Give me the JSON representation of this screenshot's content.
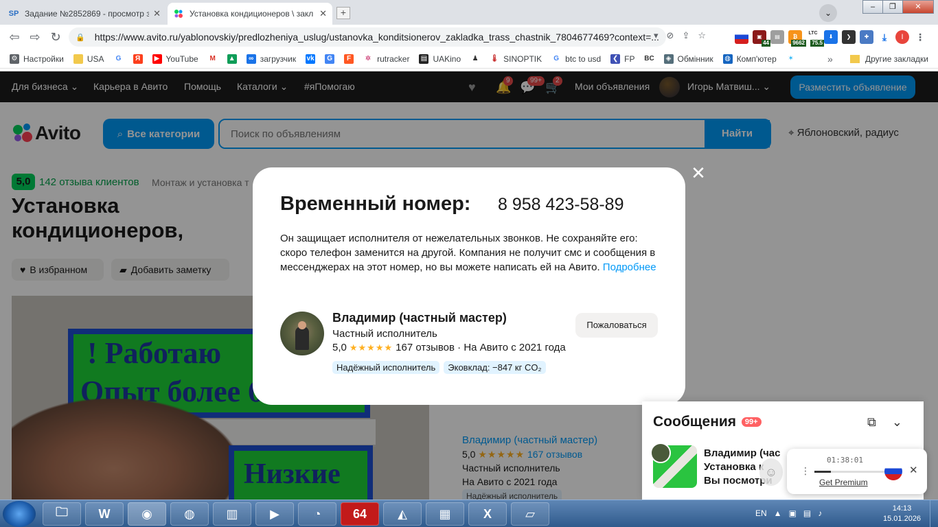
{
  "browser": {
    "tabs": [
      {
        "favicon": "SP",
        "title": "Задание №2852869 - просмотр за",
        "active": false
      },
      {
        "favicon": "avito-dots",
        "title": "Установка кондиционеров \\ закл",
        "active": true
      }
    ],
    "url": "https://www.avito.ru/yablonovskiy/predlozheniya_uslug/ustanovka_konditsionerov_zakladka_trass_chastnik_7804677469?context=...",
    "extensions": {
      "badge_44": "44",
      "badge_9662": "9662",
      "ltc_label": "LTC",
      "ltc_value": "75.5",
      "profile_letter": "I"
    },
    "bookmarks": [
      {
        "icon": "gear-icon",
        "label": "Настройки"
      },
      {
        "icon": "folder-icon",
        "label": "USA"
      },
      {
        "icon": "google-icon",
        "label": ""
      },
      {
        "icon": "yandex-icon",
        "label": ""
      },
      {
        "icon": "youtube-icon",
        "label": "YouTube"
      },
      {
        "icon": "gmail-icon",
        "label": ""
      },
      {
        "icon": "drive-icon",
        "label": ""
      },
      {
        "icon": "infinity-icon",
        "label": "загрузчик"
      },
      {
        "icon": "vk-icon",
        "label": ""
      },
      {
        "icon": "translate-icon",
        "label": ""
      },
      {
        "icon": "f-icon",
        "label": ""
      },
      {
        "icon": "rutracker-icon",
        "label": "rutracker"
      },
      {
        "icon": "uakino-icon",
        "label": "UAKino"
      },
      {
        "icon": "pawn-icon",
        "label": ""
      },
      {
        "icon": "thermometer-icon",
        "label": "SINOPTIK"
      },
      {
        "icon": "google-icon",
        "label": "btc to usd"
      },
      {
        "icon": "fp-icon",
        "label": "FP"
      },
      {
        "icon": "bc-icon",
        "label": ""
      },
      {
        "icon": "exchange-icon",
        "label": "Обмінник"
      },
      {
        "icon": "globe-icon",
        "label": "Комп'ютер"
      },
      {
        "icon": "star-icon",
        "label": ""
      }
    ],
    "bookmarks_more": "»",
    "other_bookmarks": "Другие закладки"
  },
  "avito": {
    "topnav": {
      "business": "Для бизнеса",
      "career": "Карьера в Авито",
      "help": "Помощь",
      "catalogs": "Каталоги",
      "helping": "#яПомогаю",
      "notif_count": "9",
      "messages_count": "99+",
      "cart_count": "2",
      "my_ads": "Мои объявления",
      "user_name": "Игорь Матвиш...",
      "place_ad": "Разместить объявление"
    },
    "logo_text": "Avito",
    "all_categories": "Все категории",
    "search_placeholder": "Поиск по объявлениям",
    "search_button": "Найти",
    "location": "Яблоновский, радиус",
    "rating": "5,0",
    "reviews_count": "142 отзыва клиентов",
    "breadcrumb": "Монтаж и установка т",
    "title": "Установка кондиционеров, закладка трасс (частник)",
    "favorite_button": "В избранном",
    "note_button": "Добавить заметку",
    "photo_sign_line1": "! Работаю",
    "photo_sign_line2": "Опыт более 6 лет",
    "photo_sign_low": "Низкие",
    "seller_side": {
      "name": "Владимир (частный мастер)",
      "rating": "5,0",
      "reviews": "167 отзывов",
      "type": "Частный исполнитель",
      "since": "На Авито с 2021 года",
      "badge": "Надёжный исполнитель"
    }
  },
  "modal": {
    "title": "Временный номер:",
    "phone": "8 958 423-58-89",
    "text": "Он защищает исполнителя от нежелательных звонков. Не сохраняйте его: скоро телефон заменится на другой. Компания не получит смс и сообщения в мессенджерах на этот номер, но вы можете написать ей на Авито.",
    "more_link": "Подробнее",
    "seller_name": "Владимир (частный мастер)",
    "seller_type": "Частный исполнитель",
    "rating": "5,0",
    "stars": "★★★★★",
    "reviews": "167 отзывов",
    "since": "· На Авито с 2021 года",
    "badges": [
      "Надёжный исполнитель",
      "Эковклад: −847 кг CO₂"
    ],
    "complain_button": "Пожаловаться"
  },
  "messages_widget": {
    "title": "Сообщения",
    "count": "99+",
    "line1": "Владимир (час",
    "line2": "Установка к",
    "line3": "Вы посмотри"
  },
  "recorder": {
    "time": "01:38:01",
    "premium_link": "Get Premium",
    "progress": 0.22
  },
  "taskbar": {
    "lang": "EN",
    "time": "14:13",
    "date": "15.01.2026",
    "app_64": "64"
  },
  "colors": {
    "avito_blue": "#0099f7",
    "avito_green": "#02d15c",
    "badge_red": "#e94b4b"
  }
}
